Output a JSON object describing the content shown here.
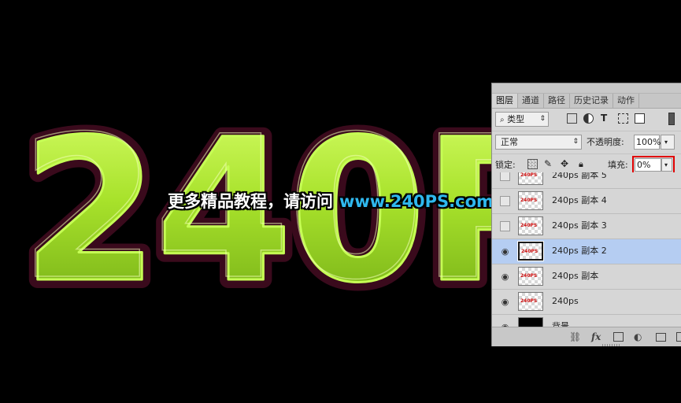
{
  "canvas": {
    "big_text": "240P",
    "colors": {
      "fill": "#a8e22b",
      "stroke": "#3a0a1c",
      "highlight": "#eaff9a",
      "background": "#000000"
    }
  },
  "watermark": {
    "cn": "更多精品教程，请访问",
    "url": "www.240PS.com"
  },
  "panel": {
    "tabs": [
      "图层",
      "通道",
      "路径",
      "历史记录",
      "动作"
    ],
    "filter_label": "类型",
    "blend_mode": "正常",
    "opacity_label": "不透明度:",
    "opacity_value": "100%",
    "lock_label": "锁定:",
    "fill_label": "填充:",
    "fill_value": "0%",
    "layers": [
      {
        "name": "240ps 副本 5",
        "visible": false,
        "thumb": "240PS"
      },
      {
        "name": "240ps 副本 4",
        "visible": false,
        "thumb": "240PS"
      },
      {
        "name": "240ps 副本 3",
        "visible": false,
        "thumb": "240PS"
      },
      {
        "name": "240ps 副本 2",
        "visible": true,
        "selected": true,
        "thumb": "240PS"
      },
      {
        "name": "240ps 副本",
        "visible": true,
        "thumb": "240PS"
      },
      {
        "name": "240ps",
        "visible": true,
        "thumb": "240PS"
      },
      {
        "name": "背景",
        "visible": true,
        "thumb": ""
      }
    ]
  }
}
